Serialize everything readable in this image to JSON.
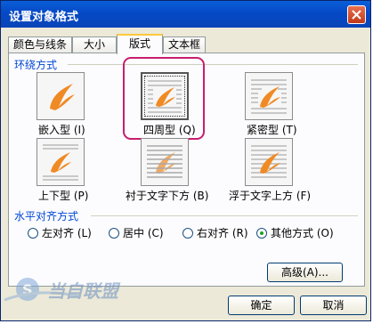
{
  "dialog": {
    "title": "设置对象格式"
  },
  "tabs": [
    {
      "label": "颜色与线条"
    },
    {
      "label": "大小"
    },
    {
      "label": "版式"
    },
    {
      "label": "文本框"
    }
  ],
  "wrap_section": {
    "label": "环绕方式",
    "options": [
      {
        "label": "嵌入型 (I)",
        "icon": "inline-wrap-icon"
      },
      {
        "label": "四周型 (Q)",
        "icon": "square-wrap-icon",
        "selected": true
      },
      {
        "label": "紧密型 (T)",
        "icon": "tight-wrap-icon"
      },
      {
        "label": "上下型 (P)",
        "icon": "top-bottom-wrap-icon"
      },
      {
        "label": "衬于文字下方 (B)",
        "icon": "behind-text-icon"
      },
      {
        "label": "浮于文字上方 (F)",
        "icon": "in-front-of-text-icon"
      }
    ]
  },
  "align_section": {
    "label": "水平对齐方式",
    "options": [
      {
        "label": "左对齐 (L)",
        "checked": false
      },
      {
        "label": "居中 (C)",
        "checked": false
      },
      {
        "label": "右对齐 (R)",
        "checked": false
      },
      {
        "label": "其他方式 (O)",
        "checked": true
      }
    ]
  },
  "buttons": {
    "advanced": "高级(A)...",
    "ok": "确定",
    "cancel": "取消"
  },
  "watermark": {
    "text": "当自联盟"
  },
  "colors": {
    "accent_title": "#0a5fd8",
    "highlight": "#c81e6f",
    "group_label": "#0046d5"
  }
}
